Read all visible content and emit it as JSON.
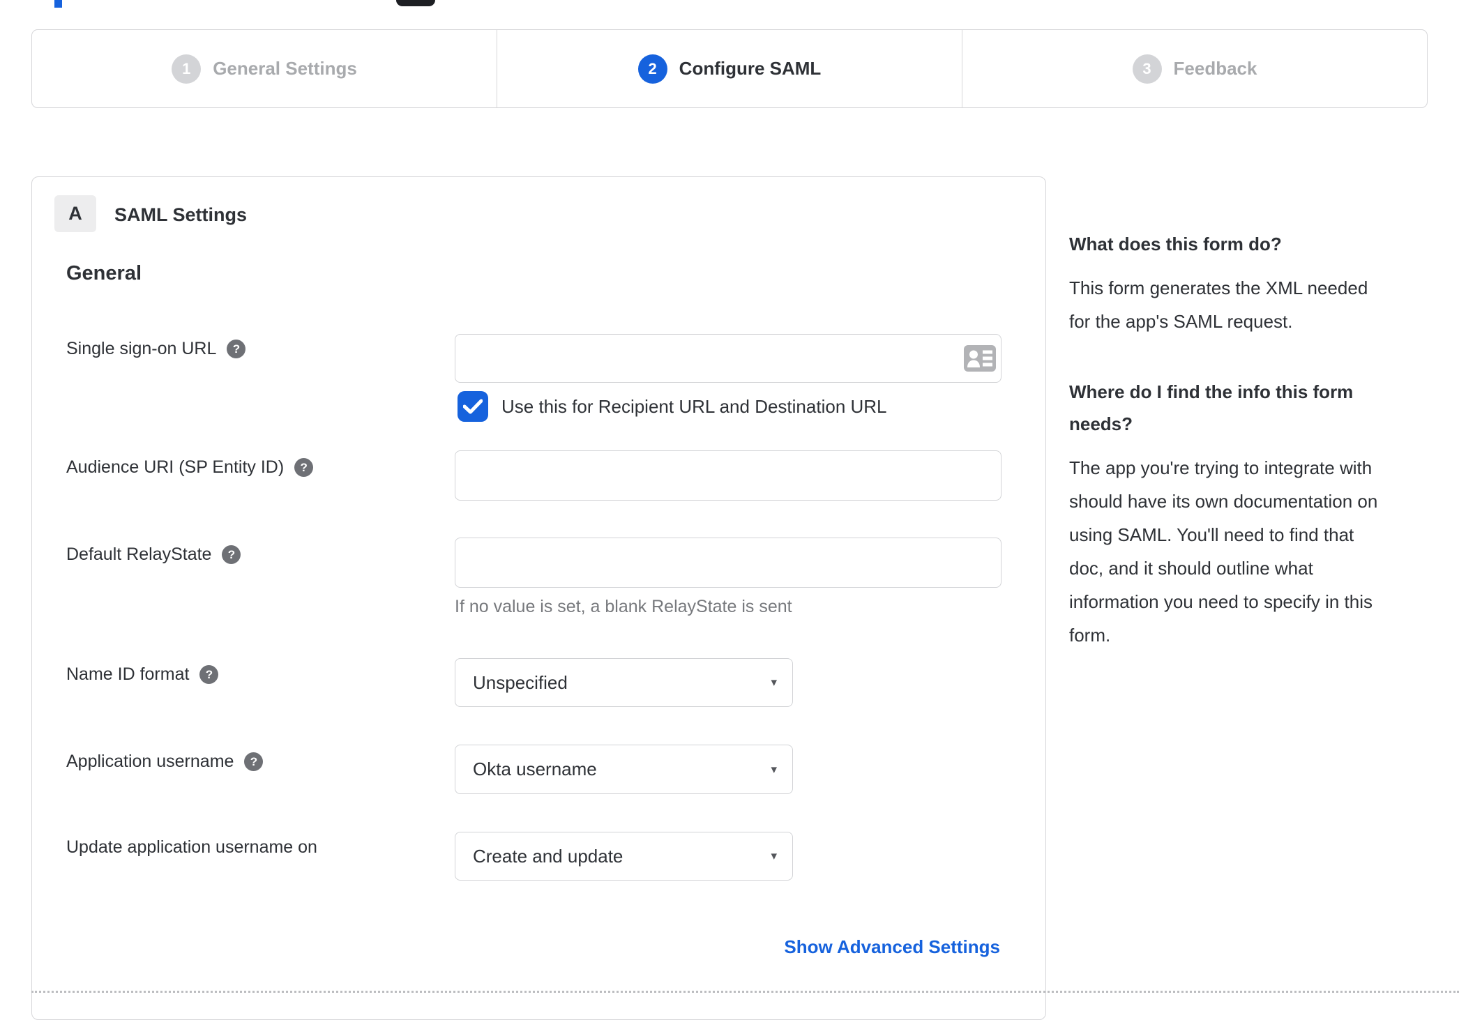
{
  "colors": {
    "accent_blue": "#1662dd",
    "border_gray": "#d6d6d9",
    "text_dark": "#2e3136",
    "inactive_gray": "#a8aaad",
    "helper_gray": "#77797d"
  },
  "stepper": {
    "steps": [
      {
        "number": "1",
        "label": "General Settings",
        "active": false
      },
      {
        "number": "2",
        "label": "Configure SAML",
        "active": true
      },
      {
        "number": "3",
        "label": "Feedback",
        "active": false
      }
    ]
  },
  "panel": {
    "badge": "A",
    "title": "SAML Settings",
    "group": "General",
    "sso": {
      "label": "Single sign-on URL",
      "value": "",
      "checkbox_label": "Use this for Recipient URL and Destination URL",
      "checked": true
    },
    "audience": {
      "label": "Audience URI (SP Entity ID)",
      "value": ""
    },
    "relay": {
      "label": "Default RelayState",
      "value": "",
      "helper": "If no value is set, a blank RelayState is sent"
    },
    "name_id": {
      "label": "Name ID format",
      "value": "Unspecified"
    },
    "app_username": {
      "label": "Application username",
      "value": "Okta username"
    },
    "update_username": {
      "label": "Update application username on",
      "value": "Create and update"
    },
    "advanced_link": "Show Advanced Settings"
  },
  "sidebar": {
    "q1": {
      "heading": "What does this form do?",
      "body": "This form generates the XML needed for the app's SAML request.",
      "body_lines": [
        "This form generates the XML needed",
        "for the app's SAML request."
      ]
    },
    "q2": {
      "heading": "Where do I find the info this form needs?",
      "heading_lines": [
        "Where do I find the info this form",
        "needs?"
      ],
      "body": "The app you're trying to integrate with should have its own documentation on using SAML. You'll need to find that doc, and it should outline what information you need to specify in this form.",
      "body_lines": [
        "The app you're trying to integrate with",
        "should have its own documentation on",
        "using SAML. You'll need to find that",
        "doc, and it should outline what",
        "information you need to specify in this",
        "form."
      ]
    }
  },
  "icons": {
    "help_glyph": "?",
    "dropdown_arrow": "▾"
  }
}
